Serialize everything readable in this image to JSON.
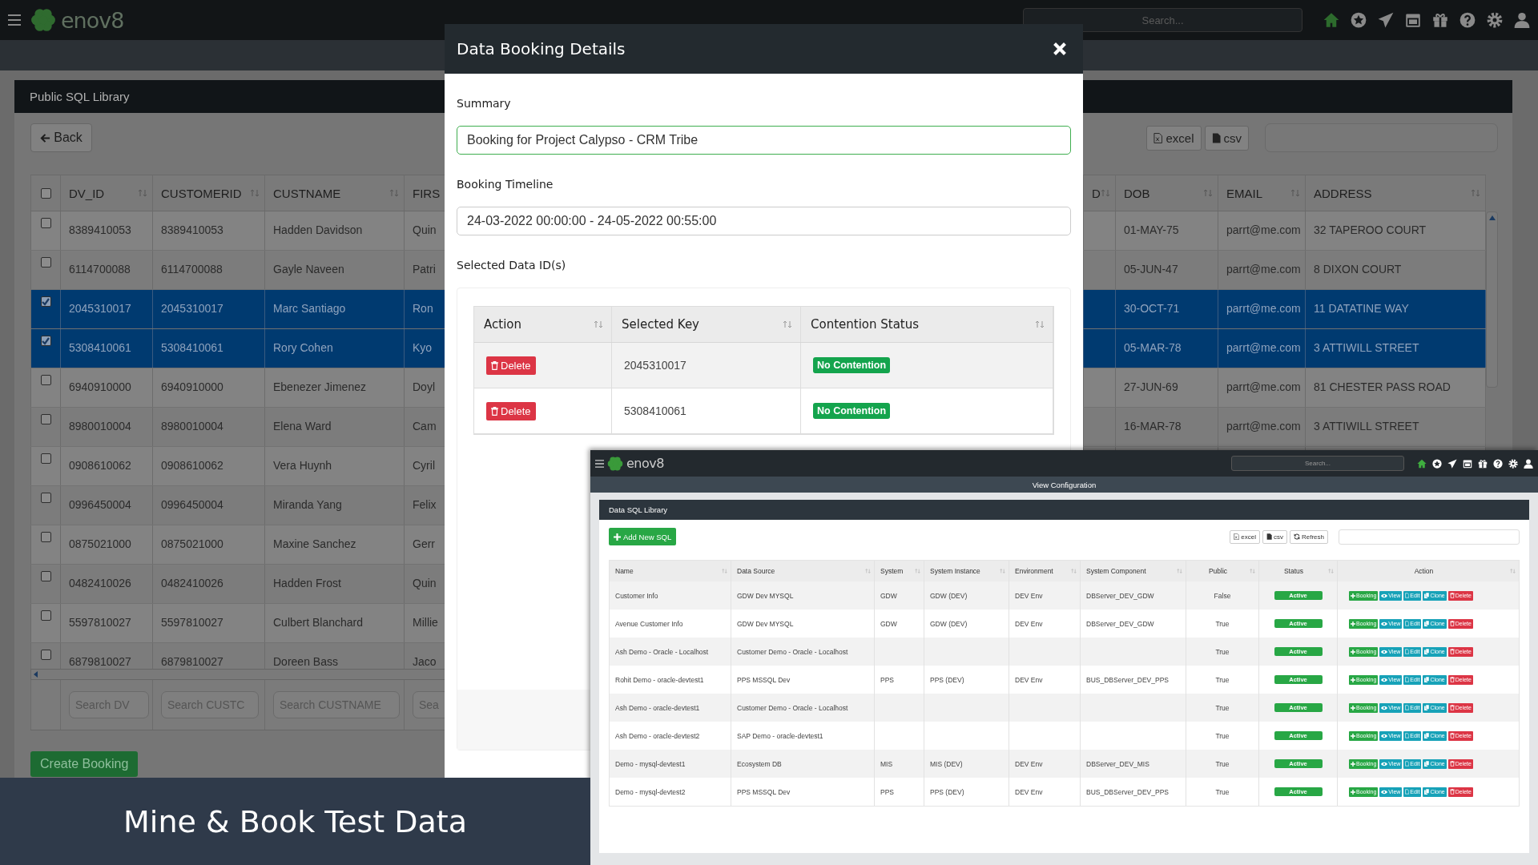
{
  "app_bar": {
    "brand": "enov8",
    "search_placeholder": "Search..."
  },
  "panel": {
    "title": "Public SQL Library",
    "back_button": "Back",
    "export_buttons": [
      {
        "label": "excel",
        "kind": "excel"
      },
      {
        "label": "csv",
        "kind": "csv"
      }
    ]
  },
  "table": {
    "select_all": {
      "checked": false
    },
    "columns": [
      "DV_ID",
      "CUSTOMERID",
      "CUSTNAME",
      "FIRS",
      "D",
      "DOB",
      "EMAIL",
      "ADDRESS"
    ],
    "rows": [
      {
        "selected": false,
        "dv_id": "8389410053",
        "customer_id": "8389410053",
        "custname": "Hadden Davidson",
        "first": "Quin",
        "dob": "01-MAY-75",
        "email": "parrt@me.com",
        "address": "32 TAPEROO COURT"
      },
      {
        "selected": false,
        "dv_id": "6114700088",
        "customer_id": "6114700088",
        "custname": "Gayle Naveen",
        "first": "Patri",
        "dob": "05-JUN-47",
        "email": "parrt@me.com",
        "address": "8 DIXON COURT"
      },
      {
        "selected": true,
        "dv_id": "2045310017",
        "customer_id": "2045310017",
        "custname": "Marc Santiago",
        "first": "Ron",
        "dob": "30-OCT-71",
        "email": "parrt@me.com",
        "address": "11 DATATINE WAY"
      },
      {
        "selected": true,
        "dv_id": "5308410061",
        "customer_id": "5308410061",
        "custname": "Rory Cohen",
        "first": "Kyo",
        "dob": "05-MAR-78",
        "email": "parrt@me.com",
        "address": "3 ATTIWILL STREET"
      },
      {
        "selected": false,
        "dv_id": "6940910000",
        "customer_id": "6940910000",
        "custname": "Ebenezer Jimenez",
        "first": "Doyl",
        "dob": "27-JUN-69",
        "email": "parrt@me.com",
        "address": "81 CHESTER PASS ROAD"
      },
      {
        "selected": false,
        "dv_id": "8980010004",
        "customer_id": "8980010004",
        "custname": "Elena Ward",
        "first": "Cam",
        "dob": "16-MAR-78",
        "email": "parrt@me.com",
        "address": "3 ATTIWILL STREET"
      },
      {
        "selected": false,
        "dv_id": "0908610062",
        "customer_id": "0908610062",
        "custname": "Vera Huynh",
        "first": "Cyril"
      },
      {
        "selected": false,
        "dv_id": "0996450004",
        "customer_id": "0996450004",
        "custname": "Miranda Yang",
        "first": "Felix"
      },
      {
        "selected": false,
        "dv_id": "0875021000",
        "customer_id": "0875021000",
        "custname": "Maxine Sanchez",
        "first": "Gerr"
      },
      {
        "selected": false,
        "dv_id": "0482410026",
        "customer_id": "0482410026",
        "custname": "Hadden Frost",
        "first": "Quin"
      },
      {
        "selected": false,
        "dv_id": "5597810027",
        "customer_id": "5597810027",
        "custname": "Culbert Blanchard",
        "first": "Millie"
      },
      {
        "selected": false,
        "dv_id": "6879810027",
        "customer_id": "6879810027",
        "custname": "Doreen Bass",
        "first": "Jaco"
      }
    ],
    "search_fields": [
      {
        "placeholder": "Search DV"
      },
      {
        "placeholder": "Search CUSTC"
      },
      {
        "placeholder": "Search CUSTNAME"
      },
      {
        "placeholder": "Sea"
      }
    ]
  },
  "create_booking": "Create Booking",
  "modal": {
    "title": "Data Booking Details",
    "summary_label": "Summary",
    "summary_value": "Booking for Project Calypso - CRM Tribe",
    "timeline_label": "Booking Timeline",
    "timeline_value": "24-03-2022 00:00:00 - 24-05-2022 00:55:00",
    "selected_label": "Selected Data ID(s)",
    "columns": [
      "Action",
      "Selected Key",
      "Contention Status"
    ],
    "rows": [
      {
        "action": "Delete",
        "key": "2045310017",
        "status": "No Contention"
      },
      {
        "action": "Delete",
        "key": "5308410061",
        "status": "No Contention"
      }
    ]
  },
  "inset": {
    "brand": "enov8",
    "search_placeholder": "Search...",
    "page_title": "View Configuration",
    "panel_title": "Data SQL Library",
    "add_button": "Add New SQL",
    "tools": [
      {
        "label": "excel",
        "kind": "excel"
      },
      {
        "label": "csv",
        "kind": "csv"
      },
      {
        "label": "Refresh",
        "kind": "refresh"
      }
    ],
    "columns": [
      "Name",
      "Data Source",
      "System",
      "System Instance",
      "Environment",
      "System Component",
      "Public",
      "Status",
      "Action"
    ],
    "rows": [
      {
        "name": "Customer Info",
        "data_source": "GDW Dev MYSQL",
        "system": "GDW",
        "system_instance": "GDW (DEV)",
        "environment": "DEV Env",
        "system_component": "DBServer_DEV_GDW",
        "public": "False",
        "status": "Active",
        "actions": [
          {
            "label": "Booking",
            "kind": "booking"
          },
          {
            "label": "View",
            "kind": "view"
          },
          {
            "label": "Edit",
            "kind": "edit"
          },
          {
            "label": "Clone",
            "kind": "clone"
          },
          {
            "label": "Delete",
            "kind": "delete"
          }
        ]
      },
      {
        "name": "Avenue Customer Info",
        "data_source": "GDW Dev MYSQL",
        "system": "GDW",
        "system_instance": "GDW (DEV)",
        "environment": "DEV Env",
        "system_component": "DBServer_DEV_GDW",
        "public": "True",
        "status": "Active",
        "actions": [
          {
            "label": "Booking",
            "kind": "booking"
          },
          {
            "label": "View",
            "kind": "view"
          },
          {
            "label": "Edit",
            "kind": "edit"
          },
          {
            "label": "Clone",
            "kind": "clone"
          },
          {
            "label": "Delete",
            "kind": "delete"
          }
        ]
      },
      {
        "name": "Ash Demo - Oracle - Localhost",
        "data_source": "Customer Demo - Oracle - Localhost",
        "public": "True",
        "status": "Active",
        "actions": [
          {
            "label": "Booking",
            "kind": "booking"
          },
          {
            "label": "View",
            "kind": "view"
          },
          {
            "label": "Edit",
            "kind": "edit"
          },
          {
            "label": "Clone",
            "kind": "clone"
          },
          {
            "label": "Delete",
            "kind": "delete"
          }
        ]
      },
      {
        "name": "Rohit Demo - oracle-devtest1",
        "data_source": "PPS MSSQL Dev",
        "system": "PPS",
        "system_instance": "PPS (DEV)",
        "environment": "DEV Env",
        "system_component": "BUS_DBServer_DEV_PPS",
        "public": "True",
        "status": "Active",
        "actions": [
          {
            "label": "Booking",
            "kind": "booking"
          },
          {
            "label": "View",
            "kind": "view"
          },
          {
            "label": "Edit",
            "kind": "edit"
          },
          {
            "label": "Clone",
            "kind": "clone"
          },
          {
            "label": "Delete",
            "kind": "delete"
          }
        ]
      },
      {
        "name": "Ash Demo - oracle-devtest1",
        "data_source": "Customer Demo - Oracle - Localhost",
        "public": "True",
        "status": "Active",
        "actions": [
          {
            "label": "Booking",
            "kind": "booking"
          },
          {
            "label": "View",
            "kind": "view"
          },
          {
            "label": "Edit",
            "kind": "edit"
          },
          {
            "label": "Clone",
            "kind": "clone"
          },
          {
            "label": "Delete",
            "kind": "delete"
          }
        ]
      },
      {
        "name": "Ash Demo - oracle-devtest2",
        "data_source": "SAP Demo - oracle-devtest1",
        "public": "True",
        "status": "Active",
        "actions": [
          {
            "label": "Booking",
            "kind": "booking"
          },
          {
            "label": "View",
            "kind": "view"
          },
          {
            "label": "Edit",
            "kind": "edit"
          },
          {
            "label": "Clone",
            "kind": "clone"
          },
          {
            "label": "Delete",
            "kind": "delete"
          }
        ]
      },
      {
        "name": "Demo - mysql-devtest1",
        "data_source": "Ecosystem DB",
        "system": "MIS",
        "system_instance": "MIS (DEV)",
        "environment": "DEV Env",
        "system_component": "DBServer_DEV_MIS",
        "public": "True",
        "status": "Active",
        "actions": [
          {
            "label": "Booking",
            "kind": "booking"
          },
          {
            "label": "View",
            "kind": "view"
          },
          {
            "label": "Edit",
            "kind": "edit"
          },
          {
            "label": "Clone",
            "kind": "clone"
          },
          {
            "label": "Delete",
            "kind": "delete"
          }
        ]
      },
      {
        "name": "Demo - mysql-devtest2",
        "data_source": "PPS MSSQL Dev",
        "system": "PPS",
        "system_instance": "PPS (DEV)",
        "environment": "DEV Env",
        "system_component": "BUS_DBServer_DEV_PPS",
        "public": "True",
        "status": "Active",
        "actions": [
          {
            "label": "Booking",
            "kind": "booking"
          },
          {
            "label": "View",
            "kind": "view"
          },
          {
            "label": "Edit",
            "kind": "edit"
          },
          {
            "label": "Clone",
            "kind": "clone"
          },
          {
            "label": "Delete",
            "kind": "delete"
          }
        ]
      }
    ]
  },
  "caption": "Mine & Book Test Data"
}
